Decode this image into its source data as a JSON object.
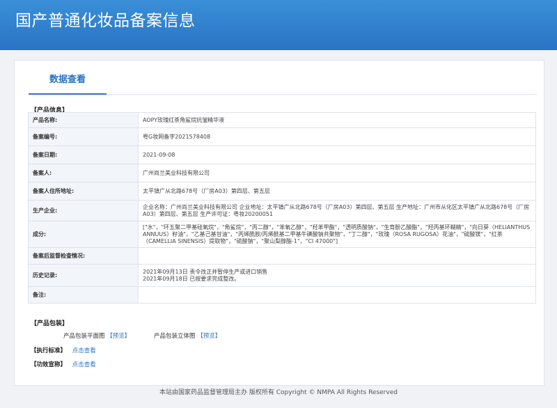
{
  "header": {
    "title": "国产普通化妆品备案信息"
  },
  "tab": {
    "label": "数据查看"
  },
  "section_product": "【产品信息】",
  "rows": [
    {
      "label": "产品名称:",
      "value": "AOPY玫瑰红茶角鲨烷抗皱精华液"
    },
    {
      "label": "备案编号:",
      "value": "粤G妆网备字2021578408"
    },
    {
      "label": "备案日期:",
      "value": "2021-09-08"
    },
    {
      "label": "备案人:",
      "value": "广州尚兰美业科技有限公司"
    },
    {
      "label": "备案人住所地址:",
      "value": "太平镇广从北路678号（厂房A03）第四层、第五层"
    },
    {
      "label": "生产企业:",
      "value": "企业名称：广州尚兰美业科技有限公司 企业地址：太平镇广从北路678号（厂房A03）第四层、第五层 生产地址：广州市从化区太平镇广从北路678号（厂房A03）第四层、第五层 生产许可证：粤妆20200051"
    },
    {
      "label": "成分:",
      "value": "[\"水\"，\"环五聚二甲基硅氧烷\"，\"角鲨烷\"，\"丙二醇\"，\"苯氧乙醇\"，\"羟苯甲酯\"，\"透明质酸钠\"，\"生育酚乙酸酯\"，\"羟丙基环糊精\"，\"向日葵（HELIANTHUS ANNUUS）籽油\"，\"乙基己基甘油\"，\"丙烯酰胺/丙烯酰基二甲基牛磺酸钠共聚物\"，\"丁二醇\"，\"玫瑰（ROSA RUGOSA）花油\"，\"硫酸镁\"，\"红茶（CAMELLIA SINENSIS）提取物\"，\"硫酸钠\"，\"聚山梨醇酯-1\"，\"CI 47000\"]"
    },
    {
      "label": "备案后监督检查情况:",
      "value": ""
    },
    {
      "label": "历史记录:",
      "value": "2021年09月13日 责令改正并暂停生产或进口销售\n2021年09月18日 已按要求完成整改。"
    },
    {
      "label": "备注:",
      "value": ""
    }
  ],
  "section_package": "【产品包装】",
  "package": {
    "flat_label": "产品包装平面图",
    "flat_link": "【预览】",
    "solid_label": "产品包装立体图",
    "solid_link": "【预览】"
  },
  "standard": {
    "label": "【执行标准】",
    "link": "点击查看"
  },
  "efficacy": {
    "label": "【功效宣称】",
    "link": "点击查看"
  },
  "footer": {
    "text": "本站由国家药品监督管理局主办 版权所有 Copyright © NMPA All Rights Reserved"
  }
}
